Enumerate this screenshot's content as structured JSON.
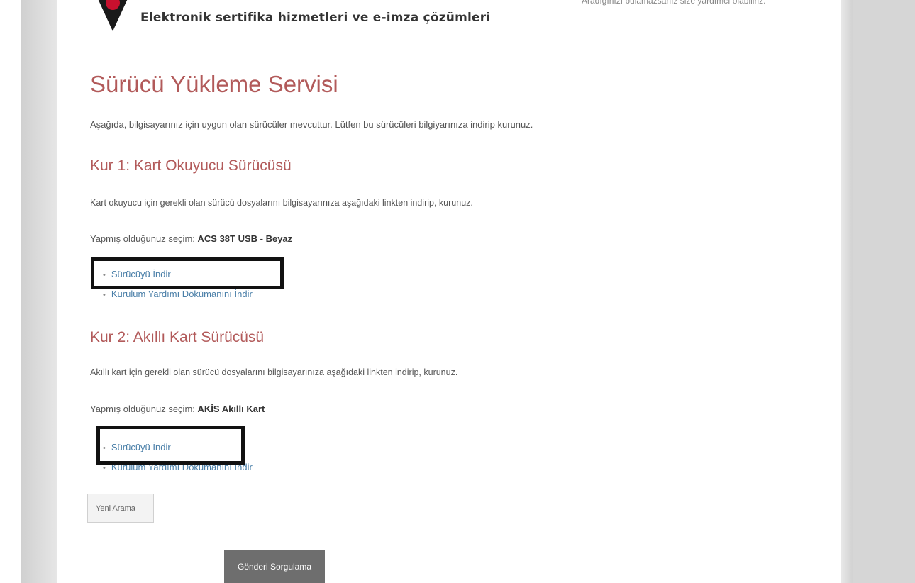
{
  "header": {
    "tagline": "Elektronik sertifika hizmetleri ve e-imza çözümleri",
    "top_right_note": "Aradığınızı bulamazsanız size yardımcı olabiliriz."
  },
  "page": {
    "title": "Sürücü Yükleme Servisi",
    "intro": "Aşağıda, bilgisayarınız için uygun olan sürücüler mevcuttur. Lütfen bu sürücüleri bilgiyarınıza indirip kurunuz."
  },
  "step1": {
    "heading": "Kur 1: Kart Okuyucu Sürücüsü",
    "description": "Kart okuyucu için gerekli olan sürücü dosyalarını bilgisayarınıza aşağıdaki linkten indirip, kurunuz.",
    "selection_label": "Yapmış olduğunuz seçim:",
    "selection_value": "ACS 38T USB - Beyaz",
    "download_driver": "Sürücüyü İndir",
    "download_guide": "Kurulum Yardımı Dökümanını İndir"
  },
  "step2": {
    "heading": "Kur 2: Akıllı Kart Sürücüsü",
    "description": "Akıllı kart için gerekli olan sürücü dosyalarını bilgisayarınıza aşağıdaki linkten indirip, kurunuz.",
    "selection_label": "Yapmış olduğunuz seçim:",
    "selection_value": "AKİS Akıllı Kart",
    "download_driver": "Sürücüyü İndir",
    "download_guide": "Kurulum Yardımı Dökümanını İndir"
  },
  "buttons": {
    "new_search": "Yeni Arama",
    "send_query": "Gönderi Sorgulama"
  }
}
